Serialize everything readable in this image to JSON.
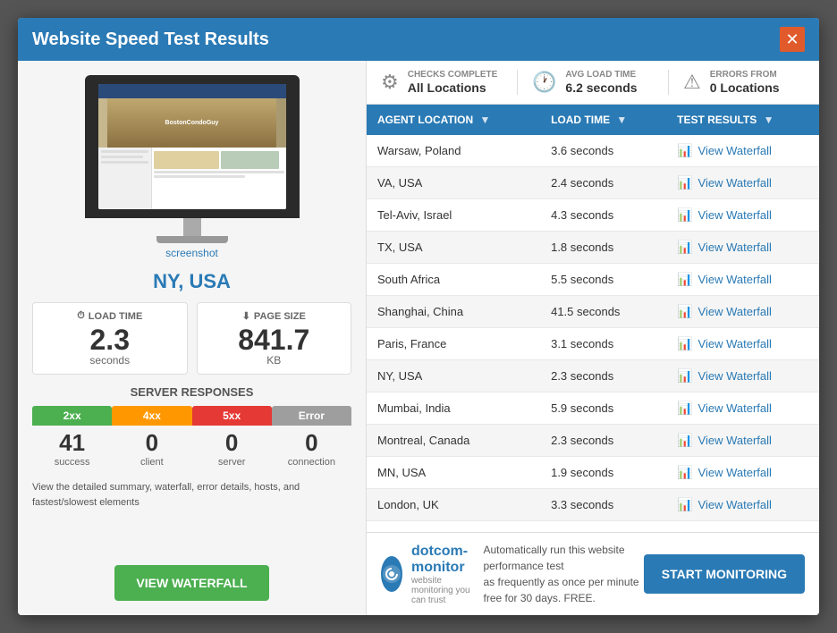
{
  "modal": {
    "title": "Website Speed Test Results",
    "close_label": "✕"
  },
  "left_panel": {
    "location": "NY, USA",
    "screenshot_link": "screenshot",
    "load_time": {
      "label": "LOAD TIME",
      "value": "2.3",
      "unit": "seconds"
    },
    "page_size": {
      "label": "PAGE SIZE",
      "value": "841.7",
      "unit": "KB"
    },
    "server_responses_title": "SERVER RESPONSES",
    "responses": [
      {
        "code": "2xx",
        "color": "green",
        "value": "41",
        "label": "success"
      },
      {
        "code": "4xx",
        "color": "orange",
        "value": "0",
        "label": "client"
      },
      {
        "code": "5xx",
        "color": "red",
        "value": "0",
        "label": "server"
      },
      {
        "code": "Error",
        "color": "gray",
        "value": "0",
        "label": "connection"
      }
    ],
    "summary_text": "View the detailed summary, waterfall, error details, hosts, and fastest/slowest elements",
    "waterfall_btn": "VIEW WATERFALL"
  },
  "right_panel": {
    "summary_bar": [
      {
        "label": "CHECKS COMPLETE",
        "value": "All Locations",
        "icon": "⚙"
      },
      {
        "label": "AVG LOAD TIME",
        "value": "6.2 seconds",
        "icon": "🕐"
      },
      {
        "label": "ERRORS FROM",
        "value": "0 Locations",
        "icon": "⚠"
      }
    ],
    "table": {
      "columns": [
        {
          "label": "AGENT LOCATION",
          "sortable": true
        },
        {
          "label": "LOAD TIME",
          "sortable": true
        },
        {
          "label": "TEST RESULTS",
          "sortable": true
        }
      ],
      "rows": [
        {
          "location": "Warsaw, Poland",
          "load_time": "3.6 seconds",
          "link": "View Waterfall"
        },
        {
          "location": "VA, USA",
          "load_time": "2.4 seconds",
          "link": "View Waterfall"
        },
        {
          "location": "Tel-Aviv, Israel",
          "load_time": "4.3 seconds",
          "link": "View Waterfall"
        },
        {
          "location": "TX, USA",
          "load_time": "1.8 seconds",
          "link": "View Waterfall"
        },
        {
          "location": "South Africa",
          "load_time": "5.5 seconds",
          "link": "View Waterfall"
        },
        {
          "location": "Shanghai, China",
          "load_time": "41.5 seconds",
          "link": "View Waterfall"
        },
        {
          "location": "Paris, France",
          "load_time": "3.1 seconds",
          "link": "View Waterfall"
        },
        {
          "location": "NY, USA",
          "load_time": "2.3 seconds",
          "link": "View Waterfall"
        },
        {
          "location": "Mumbai, India",
          "load_time": "5.9 seconds",
          "link": "View Waterfall"
        },
        {
          "location": "Montreal, Canada",
          "load_time": "2.3 seconds",
          "link": "View Waterfall"
        },
        {
          "location": "MN, USA",
          "load_time": "1.9 seconds",
          "link": "View Waterfall"
        },
        {
          "location": "London, UK",
          "load_time": "3.3 seconds",
          "link": "View Waterfall"
        }
      ]
    }
  },
  "bottom_bar": {
    "logo_text_main": "dotcom-monitor",
    "logo_text_sub": "website monitoring you can trust",
    "message_line1": "Automatically run this website performance test",
    "message_line2": "as frequently as once per minute free for 30 days. FREE.",
    "cta_btn": "START MONITORING"
  }
}
